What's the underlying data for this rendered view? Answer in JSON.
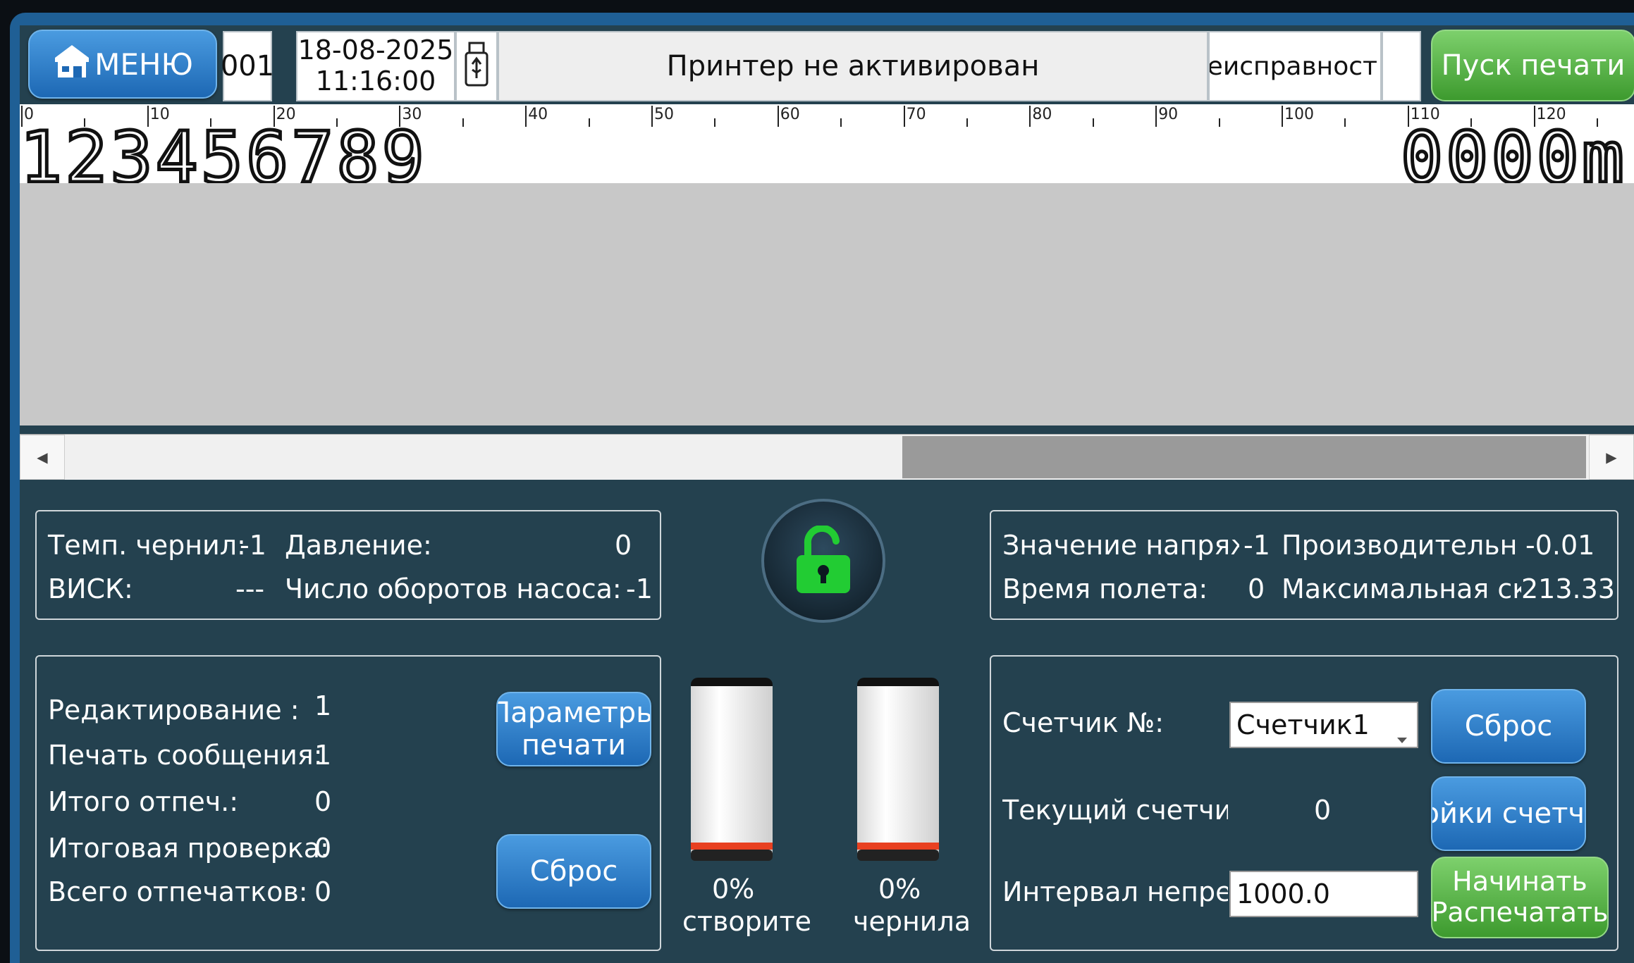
{
  "topbar": {
    "menu_label": "МЕНЮ",
    "print_number": "001",
    "date": "18-08-2025",
    "time": "11:16:00",
    "printer_status": "Принтер не активирован",
    "fault_status": "Неисправност",
    "start_print_label": "Пуск печати"
  },
  "ruler": {
    "ticks": [
      "0",
      "10",
      "20",
      "30",
      "40",
      "50",
      "60",
      "70",
      "80",
      "90",
      "100",
      "110",
      "120"
    ]
  },
  "message": {
    "left_text": "123456789",
    "right_text": "0000m"
  },
  "status_panel_left": {
    "ink_temp_label": "Темп. чернил:",
    "ink_temp_value": "-1",
    "pressure_label": "Давление:",
    "pressure_value": "0",
    "visc_label": "ВИСК:",
    "visc_value": "---",
    "pump_rpm_label": "Число оборотов насоса:",
    "pump_rpm_value": "-1"
  },
  "status_panel_right": {
    "voltage_label": "Значение напряж",
    "voltage_value": "-1",
    "performance_label": "Производительно",
    "performance_value": "-0.01",
    "flight_time_label": "Время полета:",
    "flight_time_value": "0",
    "max_speed_label": "Максимальная ск",
    "max_speed_value": "213.33"
  },
  "counters_panel": {
    "edit_label": "Редактирование :",
    "edit_value": "1",
    "print_msg_label": "Печать сообщения:",
    "print_msg_value": "1",
    "total_printed_label": "Итого отпеч.:",
    "total_printed_value": "0",
    "final_check_label": "Итоговая проверка:",
    "final_check_value": "0",
    "all_prints_label": "Всего отпечатков:",
    "all_prints_value": "0",
    "print_params_line1": "Параметры",
    "print_params_line2": "печати",
    "reset_label": "Сброс"
  },
  "cartridges": [
    {
      "percent": "0%",
      "label": "створите",
      "level": 0
    },
    {
      "percent": "0%",
      "label": "чернила",
      "level": 0
    }
  ],
  "counter_panel": {
    "counter_no_label": "Счетчик №:",
    "counter_select": "Счетчик1",
    "reset_label": "Сброс",
    "current_counter_label": "Текущий счетчик",
    "current_counter_value": "0",
    "counter_settings_label": "тройки счетч",
    "interval_label": "Интервал непре",
    "interval_value": "1000.0",
    "begin_print_line1": "Начинать",
    "begin_print_line2": "Распечатать"
  },
  "colors": {
    "accent_blue": "#1d68b4",
    "accent_green": "#3d9a2e",
    "panel_bg": "#24414f",
    "unlock_green": "#22cc33"
  }
}
